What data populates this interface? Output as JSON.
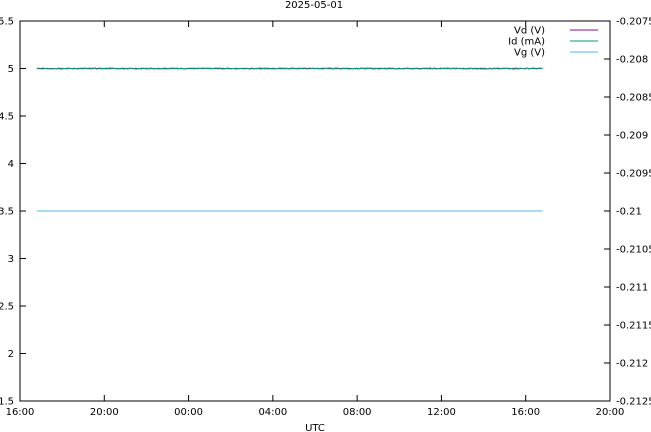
{
  "chart_data": {
    "type": "line",
    "title": "2025-05-01",
    "xlabel": "UTC",
    "x_ticks": [
      "16:00",
      "20:00",
      "00:00",
      "04:00",
      "08:00",
      "12:00",
      "16:00",
      "20:00"
    ],
    "xlim_hours": [
      0,
      28
    ],
    "y_left": {
      "ylim": [
        1.5,
        5.5
      ],
      "ticks": [
        "1.5",
        "2",
        "2.5",
        "3",
        "3.5",
        "4",
        "4.5",
        "5",
        "5.5"
      ]
    },
    "y_right": {
      "ylim": [
        -0.2125,
        -0.2075
      ],
      "ticks": [
        "-0.2125",
        "-0.212",
        "-0.2115",
        "-0.211",
        "-0.2105",
        "-0.21",
        "-0.2095",
        "-0.209",
        "-0.2085",
        "-0.208",
        "-0.2075"
      ]
    },
    "grid": false,
    "legend_position": "top-right",
    "series": [
      {
        "name": "Vd (V)",
        "color": "#8b0a8b",
        "axis": "left",
        "x_range_hours": [
          0.8,
          24.8
        ],
        "value": 5.0,
        "noise": 0.004
      },
      {
        "name": "Id (mA)",
        "color": "#009e73",
        "axis": "left",
        "x_range_hours": [
          0.8,
          24.8
        ],
        "value": 5.0,
        "noise": 0.006
      },
      {
        "name": "Vg (V)",
        "color": "#56b4e9",
        "axis": "left",
        "x_range_hours": [
          0.8,
          24.8
        ],
        "value": 3.5,
        "noise": 0
      }
    ]
  }
}
